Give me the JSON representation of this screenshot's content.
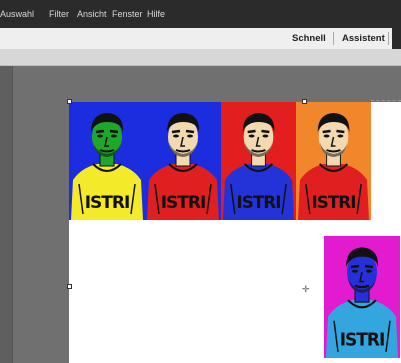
{
  "menu": [
    "Auswahl",
    "Filter",
    "Ansicht",
    "Fenster",
    "Hilfe"
  ],
  "modes": {
    "schnell": "Schnell",
    "assistent": "Assistent"
  },
  "tiles": [
    {
      "bg": "#1c2de0",
      "face": "#1ea82a",
      "shirt": "#f3ea2a"
    },
    {
      "bg": "#1c2de0",
      "face": "#f2d9b0",
      "shirt": "#e02020"
    },
    {
      "bg": "#e21e1e",
      "face": "#f2d9b0",
      "shirt": "#2433d8"
    },
    {
      "bg": "#f2862a",
      "face": "#f2d9b0",
      "shirt": "#e02020"
    },
    {
      "bg": "#e21ad0",
      "face": "#2530d8",
      "shirt": "#33a6e0"
    }
  ],
  "shirt_text": "ISTRI",
  "colors": {
    "menubar": "#2b2b2b",
    "modebar": "#efefef",
    "workspace": "#707070",
    "document": "#ffffff"
  }
}
